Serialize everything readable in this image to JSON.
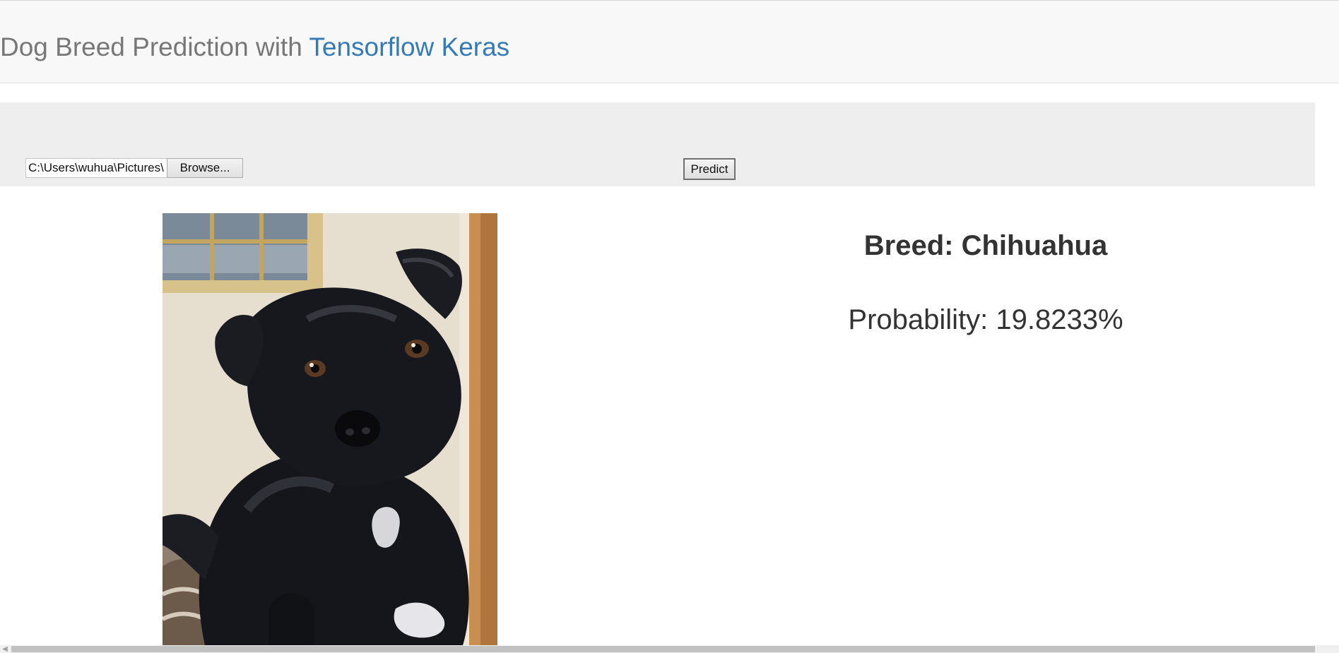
{
  "header": {
    "title_prefix": "Dog Breed Prediction with ",
    "title_accent": "Tensorflow Keras",
    "accent_color": "#337ab7"
  },
  "toolbar": {
    "file_path_value": "C:\\Users\\wuhua\\Pictures\\",
    "browse_label": "Browse...",
    "predict_label": "Predict"
  },
  "result": {
    "breed_text": "Breed: Chihuahua",
    "probability_text": "Probability: 19.8233%"
  },
  "icons": {
    "scroll_left": "chevron-left-icon"
  }
}
